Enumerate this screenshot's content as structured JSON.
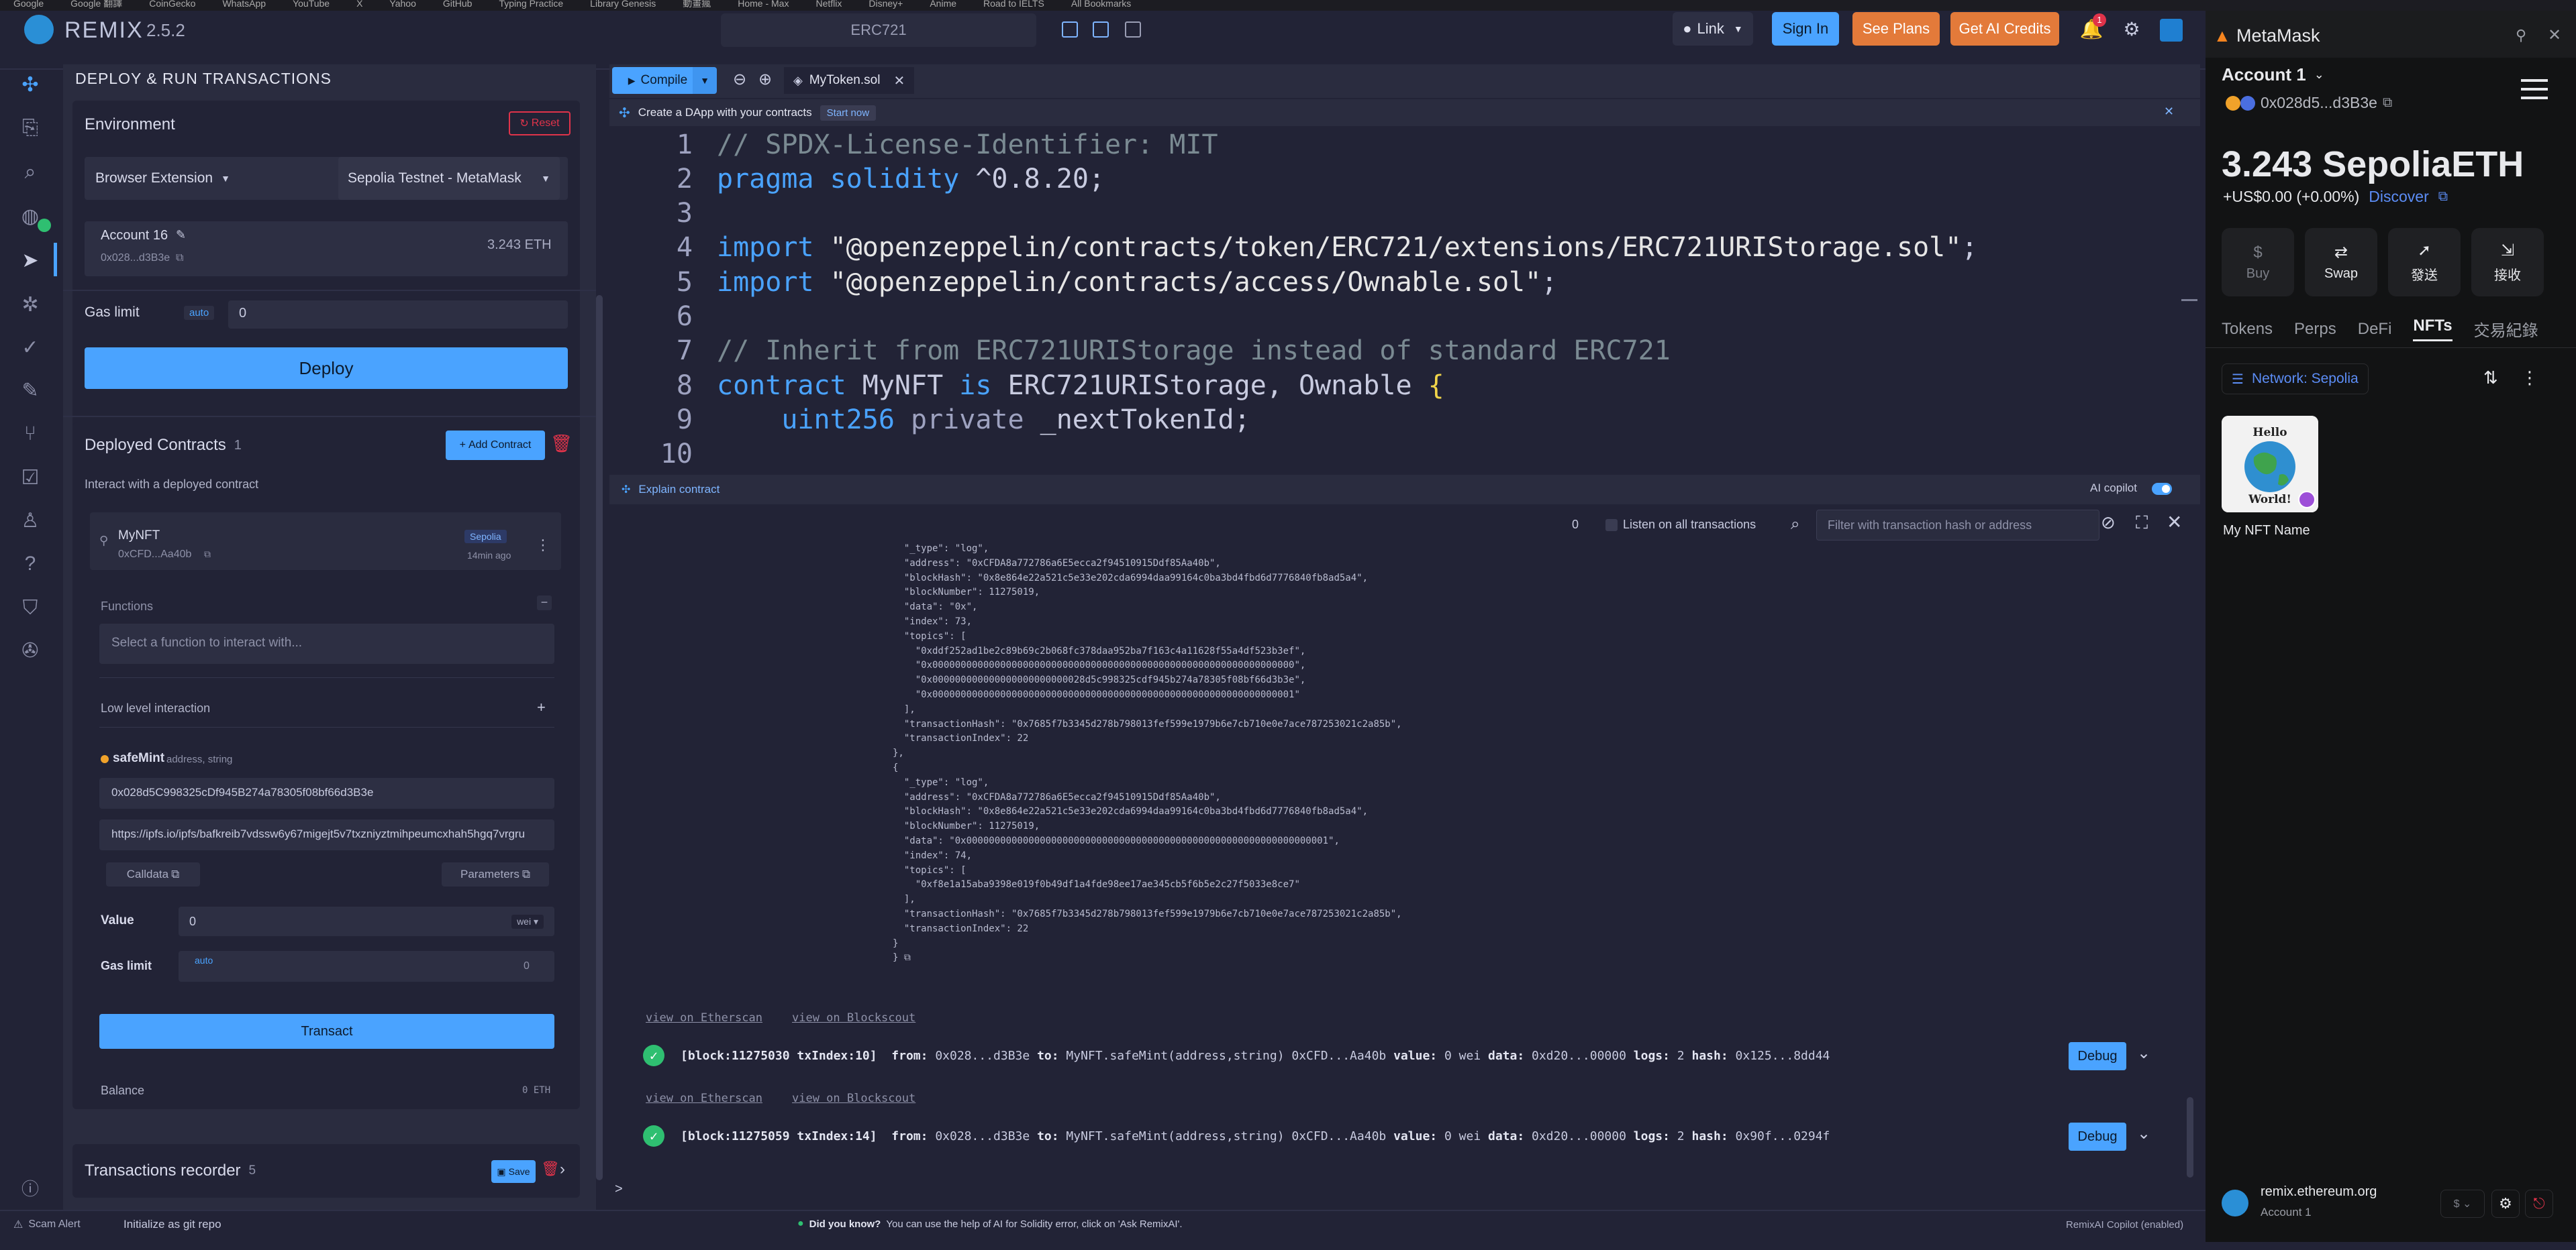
{
  "bookmarks": [
    "Google",
    "Google 翻譯",
    "CoinGecko",
    "WhatsApp",
    "YouTube",
    "X",
    "Yahoo",
    "GitHub",
    "Typing Practice",
    "Library Genesis",
    "動畫瘋",
    "Home - Max",
    "Netflix",
    "Disney+",
    "Anime",
    "Road to IELTS",
    "All Bookmarks"
  ],
  "header": {
    "app_name": "REMIX",
    "version": "2.5.2",
    "search_text": "ERC721",
    "link_label": "Link",
    "signin_label": "Sign In",
    "plans_label": "See Plans",
    "credits_label": "Get AI Credits",
    "notification_count": "1"
  },
  "panel": {
    "title": "DEPLOY & RUN TRANSACTIONS",
    "environment_label": "Environment",
    "reset_label": "Reset",
    "provider": "Browser Extension",
    "network": "Sepolia Testnet - MetaMask",
    "account_name": "Account 16",
    "account_address": "0x028...d3B3e",
    "account_balance": "3.243 ETH",
    "gas_limit_label": "Gas limit",
    "gas_auto": "auto",
    "gas_value": "0",
    "deploy_label": "Deploy",
    "deployed_title": "Deployed Contracts",
    "deployed_count": "1",
    "add_contract_label": "Add Contract",
    "interact_text": "Interact with a deployed contract",
    "contract": {
      "name": "MyNFT",
      "address": "0xCFD...Aa40b",
      "network_badge": "Sepolia",
      "age": "14min ago"
    },
    "functions_label": "Functions",
    "function_placeholder": "Select a function to interact with...",
    "low_level_label": "Low level interaction",
    "method_name": "safeMint",
    "method_params": "address, string",
    "param_address": "0x028d5C998325cDf945B274a78305f08bf66d3B3e",
    "param_uri": "https://ipfs.io/ipfs/bafkreib7vdssw6y67migejt5v7txzniyztmihpeumcxhah5hgq7vrgru",
    "calldata_label": "Calldata",
    "parameters_label": "Parameters",
    "value_label": "Value",
    "value_amount": "0",
    "value_unit": "wei",
    "gas_limit_label2": "Gas limit",
    "gas_auto2": "auto",
    "gas_value2": "0",
    "transact_label": "Transact",
    "balance_label": "Balance",
    "balance_value": "0 ETH",
    "recorder_title": "Transactions recorder",
    "recorder_count": "5",
    "save_label": "Save"
  },
  "editor": {
    "compile_label": "Compile",
    "tab_name": "MyToken.sol",
    "banner_text": "Create a DApp with your contracts",
    "banner_cta": "Start now",
    "lines": [
      {
        "n": "1",
        "parts": [
          {
            "t": "// SPDX-License-Identifier: MIT",
            "c": "c-com"
          }
        ]
      },
      {
        "n": "2",
        "parts": [
          {
            "t": "pragma",
            "c": "c-kw"
          },
          {
            "t": " solidity ",
            "c": "c-kw"
          },
          {
            "t": "^0.8.20;",
            "c": "c-id"
          }
        ]
      },
      {
        "n": "3",
        "parts": []
      },
      {
        "n": "4",
        "parts": [
          {
            "t": "import ",
            "c": "c-kw"
          },
          {
            "t": "\"@openzeppelin/contracts/token/ERC721/extensions/ERC721URIStorage.sol\"",
            "c": "c-str"
          },
          {
            "t": ";",
            "c": "c-id"
          }
        ]
      },
      {
        "n": "5",
        "parts": [
          {
            "t": "import ",
            "c": "c-kw"
          },
          {
            "t": "\"@openzeppelin/contracts/access/Ownable.sol\"",
            "c": "c-str"
          },
          {
            "t": ";",
            "c": "c-id"
          }
        ]
      },
      {
        "n": "6",
        "parts": []
      },
      {
        "n": "7",
        "parts": [
          {
            "t": "// Inherit from ERC721URIStorage instead of standard ERC721",
            "c": "c-com"
          }
        ]
      },
      {
        "n": "8",
        "parts": [
          {
            "t": "contract ",
            "c": "c-kw"
          },
          {
            "t": "MyNFT ",
            "c": "c-id"
          },
          {
            "t": "is ",
            "c": "c-kw"
          },
          {
            "t": "ERC721URIStorage, Ownable ",
            "c": "c-id"
          },
          {
            "t": "{",
            "c": "c-br"
          }
        ]
      },
      {
        "n": "9",
        "parts": [
          {
            "t": "    uint256 ",
            "c": "c-kw"
          },
          {
            "t": "private ",
            "c": "c-ty"
          },
          {
            "t": "_nextTokenId;",
            "c": "c-id"
          }
        ]
      },
      {
        "n": "10",
        "parts": []
      }
    ]
  },
  "terminal": {
    "explain_label": "Explain contract",
    "copilot_label": "AI copilot",
    "pending_count": "0",
    "listen_label": "Listen on all transactions",
    "filter_placeholder": "Filter with transaction hash or address",
    "log_text": "  \"_type\": \"log\",\n  \"address\": \"0xCFDA8a772786a6E5ecca2f94510915Ddf85Aa40b\",\n  \"blockHash\": \"0x8e864e22a521c5e33e202cda6994daa99164c0ba3bd4fbd6d7776840fb8ad5a4\",\n  \"blockNumber\": 11275019,\n  \"data\": \"0x\",\n  \"index\": 73,\n  \"topics\": [\n    \"0xddf252ad1be2c89b69c2b068fc378daa952ba7f163c4a11628f55a4df523b3ef\",\n    \"0x0000000000000000000000000000000000000000000000000000000000000000\",\n    \"0x000000000000000000000000028d5c998325cdf945b274a78305f08bf66d3b3e\",\n    \"0x0000000000000000000000000000000000000000000000000000000000000001\"\n  ],\n  \"transactionHash\": \"0x7685f7b3345d278b798013fef599e1979b6e7cb710e0e7ace787253021c2a85b\",\n  \"transactionIndex\": 22\n},\n{\n  \"_type\": \"log\",\n  \"address\": \"0xCFDA8a772786a6E5ecca2f94510915Ddf85Aa40b\",\n  \"blockHash\": \"0x8e864e22a521c5e33e202cda6994daa99164c0ba3bd4fbd6d7776840fb8ad5a4\",\n  \"blockNumber\": 11275019,\n  \"data\": \"0x0000000000000000000000000000000000000000000000000000000000000001\",\n  \"index\": 74,\n  \"topics\": [\n    \"0xf8e1a15aba9398e019f0b49df1a4fde98ee17ae345cb5f6b5e2c27f5033e8ce7\"\n  ],\n  \"transactionHash\": \"0x7685f7b3345d278b798013fef599e1979b6e7cb710e0e7ace787253021c2a85b\",\n  \"transactionIndex\": 22\n}\n} ⧉",
    "etherscan_label": "view on Etherscan",
    "blockscout_label": "view on Blockscout",
    "tx1": {
      "block": "[block:11275030 txIndex:10]",
      "from": "0x028...d3B3e",
      "to": "MyNFT.safeMint(address,string) 0xCFD...Aa40b",
      "value": "0 wei",
      "data": "0xd20...00000",
      "logs": "2",
      "hash": "0x125...8dd44"
    },
    "tx2": {
      "block": "[block:11275059 txIndex:14]",
      "from": "0x028...d3B3e",
      "to": "MyNFT.safeMint(address,string) 0xCFD...Aa40b",
      "value": "0 wei",
      "data": "0xd20...00000",
      "logs": "2",
      "hash": "0x90f...0294f"
    },
    "debug_label": "Debug",
    "prompt": ">"
  },
  "statusbar": {
    "scam_alert": "Scam Alert",
    "git_init": "Initialize as git repo",
    "did_you_know": "Did you know?",
    "tip": "You can use the help of AI for Solidity error, click on 'Ask RemixAI'.",
    "copilot_status": "RemixAI Copilot (enabled)"
  },
  "metamask": {
    "title": "MetaMask",
    "account": "Account 1",
    "address": "0x028d5...d3B3e",
    "balance": "3.243 SepoliaETH",
    "fiat": "+US$0.00 (+0.00%)",
    "discover": "Discover",
    "actions": [
      {
        "label": "Buy",
        "icon": "$"
      },
      {
        "label": "Swap",
        "icon": "⇄"
      },
      {
        "label": "發送",
        "icon": "➚"
      },
      {
        "label": "接收",
        "icon": "⇲"
      }
    ],
    "tabs": [
      "Tokens",
      "Perps",
      "DeFi",
      "NFTs",
      "交易紀錄"
    ],
    "active_tab": "NFTs",
    "network_filter": "Network: Sepolia",
    "nft_name": "My NFT Name",
    "nft_art_text": "Hello World!",
    "site": "remix.ethereum.org",
    "site_account": "Account 1"
  },
  "colors": {
    "accent": "#4aa3ff",
    "orange": "#e37a3a",
    "success": "#2fbf71",
    "remix_bg": "#222336",
    "metamask_bg": "#121314"
  }
}
